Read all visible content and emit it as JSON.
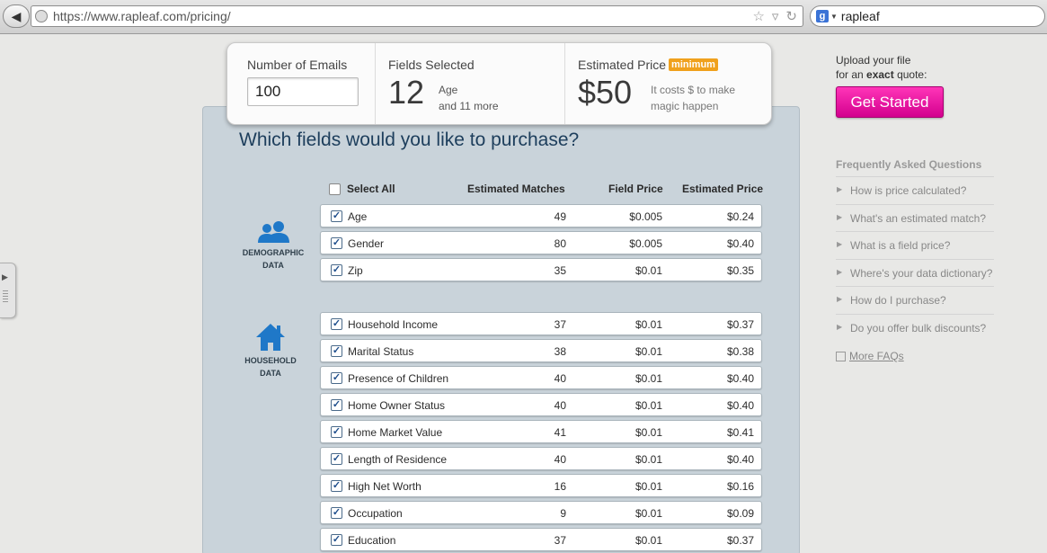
{
  "browser": {
    "url": "https://www.rapleaf.com/pricing/",
    "search_query": "rapleaf"
  },
  "summary": {
    "emails_label": "Number of Emails",
    "emails_value": "100",
    "fields_label": "Fields Selected",
    "fields_count": "12",
    "fields_line1": "Age",
    "fields_line2": "and 11 more",
    "price_label": "Estimated Price",
    "price_badge": "minimum",
    "price_value": "$50",
    "price_note1": "It costs $ to make",
    "price_note2": "magic happen"
  },
  "question": "Which fields would you like to purchase?",
  "table_headers": {
    "select_all": "Select All",
    "matches": "Estimated Matches",
    "field_price": "Field Price",
    "estimated_price": "Estimated Price"
  },
  "categories": [
    {
      "line1": "DEMOGRAPHIC",
      "line2": "DATA",
      "icon": "people-icon"
    },
    {
      "line1": "HOUSEHOLD",
      "line2": "DATA",
      "icon": "house-icon"
    }
  ],
  "rows": [
    {
      "name": "Age",
      "matches": "49",
      "field_price": "$0.005",
      "estimated_price": "$0.24"
    },
    {
      "name": "Gender",
      "matches": "80",
      "field_price": "$0.005",
      "estimated_price": "$0.40"
    },
    {
      "name": "Zip",
      "matches": "35",
      "field_price": "$0.01",
      "estimated_price": "$0.35"
    },
    {
      "name": "Household Income",
      "matches": "37",
      "field_price": "$0.01",
      "estimated_price": "$0.37"
    },
    {
      "name": "Marital Status",
      "matches": "38",
      "field_price": "$0.01",
      "estimated_price": "$0.38"
    },
    {
      "name": "Presence of Children",
      "matches": "40",
      "field_price": "$0.01",
      "estimated_price": "$0.40"
    },
    {
      "name": "Home Owner Status",
      "matches": "40",
      "field_price": "$0.01",
      "estimated_price": "$0.40"
    },
    {
      "name": "Home Market Value",
      "matches": "41",
      "field_price": "$0.01",
      "estimated_price": "$0.41"
    },
    {
      "name": "Length of Residence",
      "matches": "40",
      "field_price": "$0.01",
      "estimated_price": "$0.40"
    },
    {
      "name": "High Net Worth",
      "matches": "16",
      "field_price": "$0.01",
      "estimated_price": "$0.16"
    },
    {
      "name": "Occupation",
      "matches": "9",
      "field_price": "$0.01",
      "estimated_price": "$0.09"
    },
    {
      "name": "Education",
      "matches": "37",
      "field_price": "$0.01",
      "estimated_price": "$0.37"
    }
  ],
  "sidebar": {
    "upload_line1": "Upload your file",
    "upload_pre": "for an ",
    "upload_bold": "exact",
    "upload_post": " quote:",
    "start_button": "Get Started",
    "faq_title": "Frequently Asked Questions",
    "faqs": [
      "How is price calculated?",
      "What's an estimated match?",
      "What is a field price?",
      "Where's your data dictionary?",
      "How do I purchase?",
      "Do you offer bulk discounts?"
    ],
    "more_faqs": "More FAQs"
  },
  "colors": {
    "accent": "#e6008f",
    "badge": "#f0a11d",
    "icon_blue": "#1f78c8",
    "panel": "#c9d3da"
  }
}
